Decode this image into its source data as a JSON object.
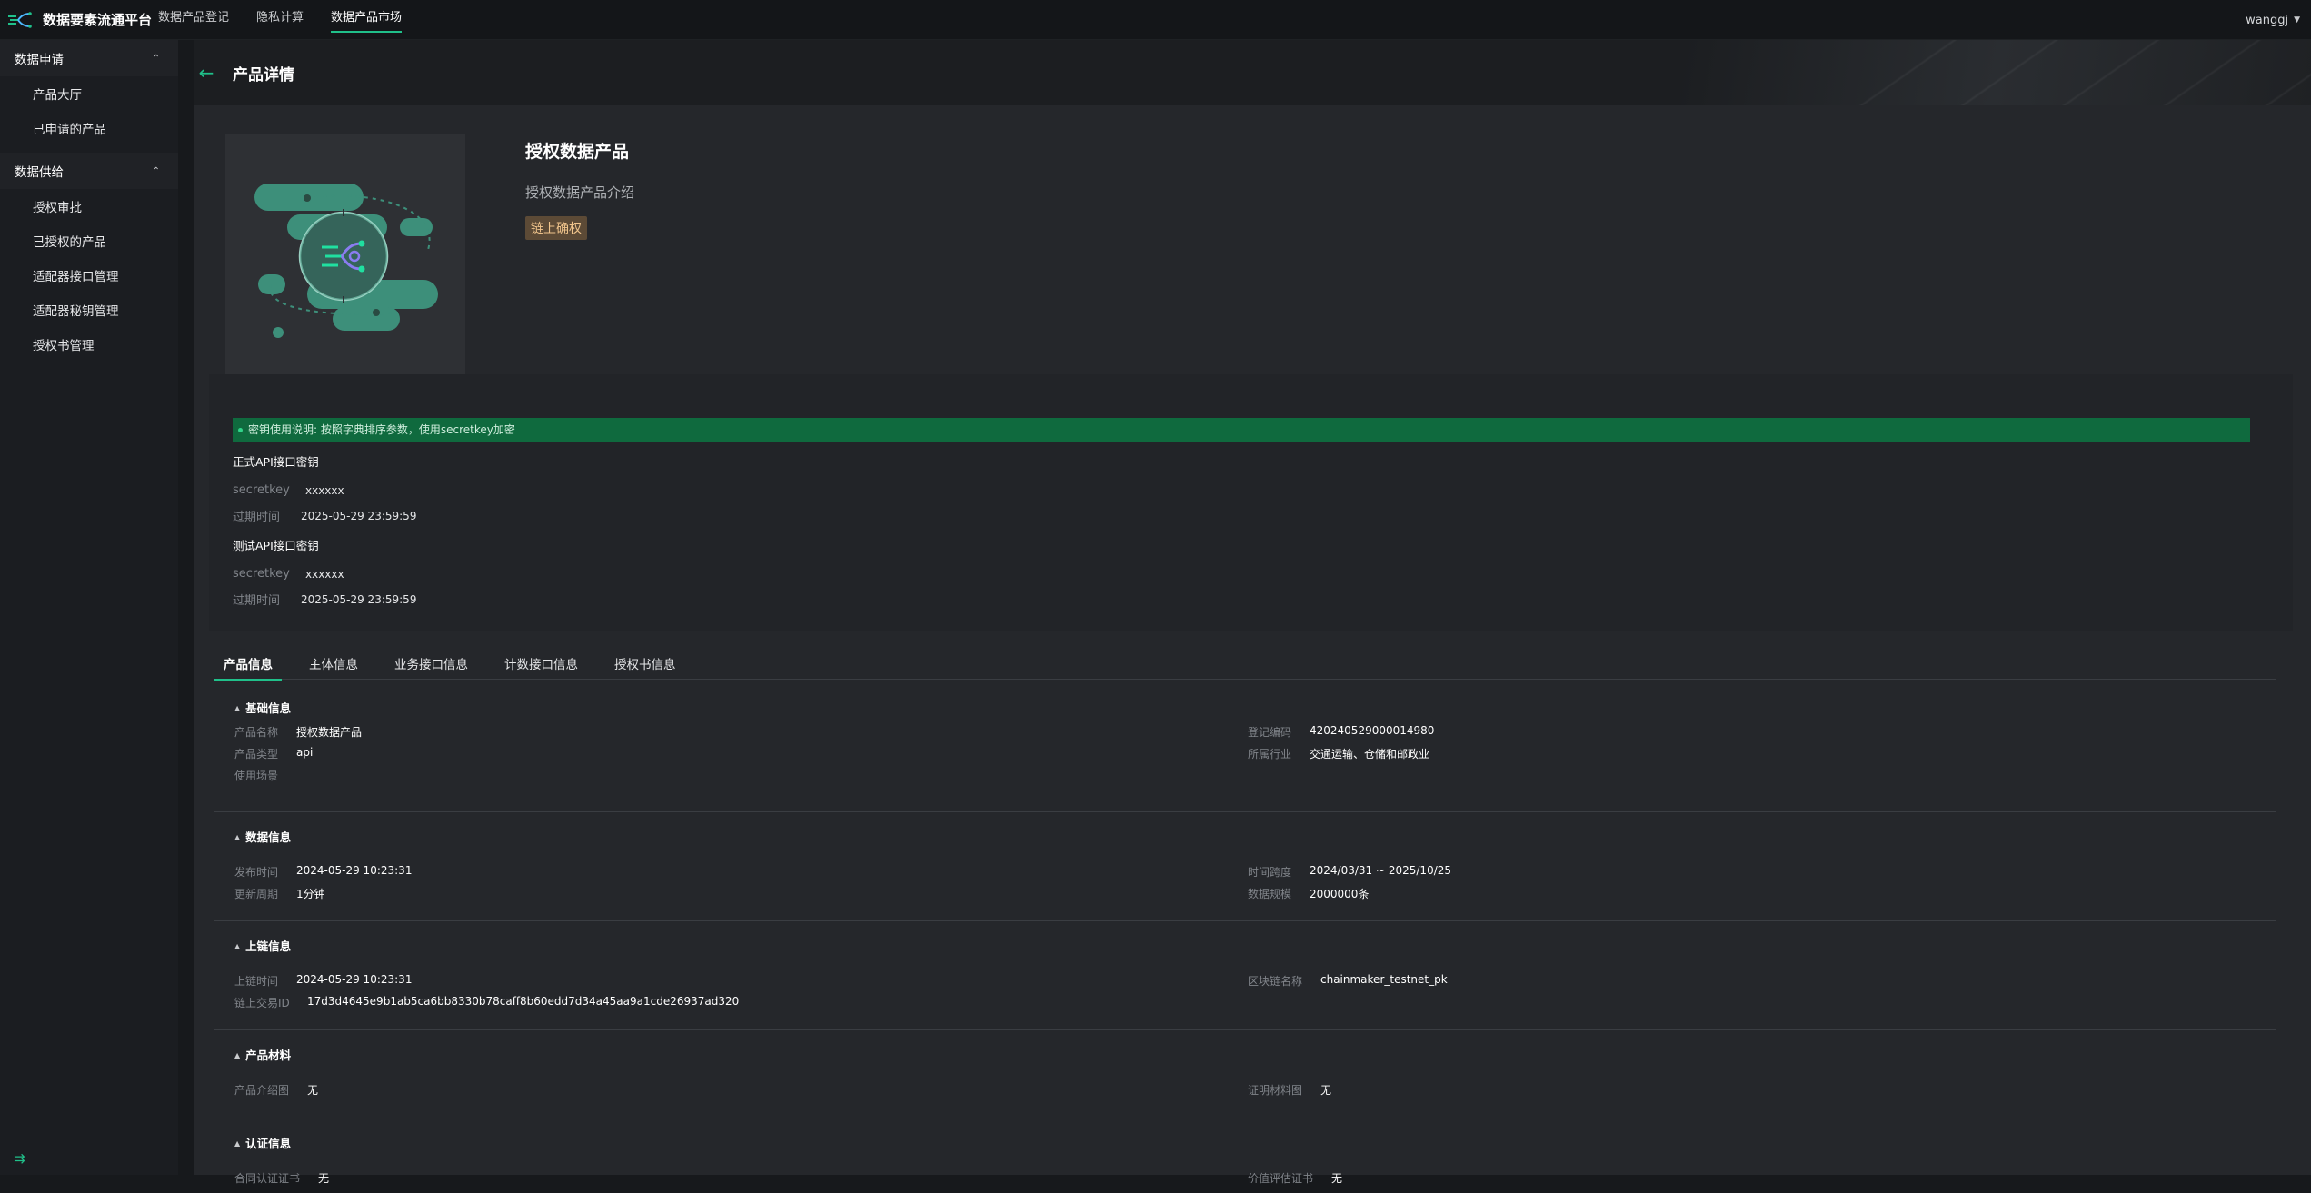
{
  "header": {
    "brand": "数据要素流通平台",
    "nav": [
      "数据产品登记",
      "隐私计算",
      "数据产品市场"
    ],
    "active_nav": "数据产品市场",
    "user": "wanggj"
  },
  "sidebar": {
    "groups": [
      {
        "title": "数据申请",
        "items": [
          "产品大厅",
          "已申请的产品"
        ]
      },
      {
        "title": "数据供给",
        "items": [
          "授权审批",
          "已授权的产品",
          "适配器接口管理",
          "适配器秘钥管理",
          "授权书管理"
        ]
      }
    ]
  },
  "page": {
    "title": "产品详情"
  },
  "product": {
    "name": "授权数据产品",
    "intro": "授权数据产品介绍",
    "tag": "链上确权"
  },
  "keys": {
    "notice": "密钥使用说明: 按照字典排序参数，使用secretkey加密",
    "formal": {
      "title": "正式API接口密钥",
      "secretkey_label": "secretkey",
      "secretkey": "xxxxxx",
      "expire_label": "过期时间",
      "expire": "2025-05-29 23:59:59"
    },
    "test": {
      "title": "测试API接口密钥",
      "secretkey_label": "secretkey",
      "secretkey": "xxxxxx",
      "expire_label": "过期时间",
      "expire": "2025-05-29 23:59:59"
    }
  },
  "tabs": [
    "产品信息",
    "主体信息",
    "业务接口信息",
    "计数接口信息",
    "授权书信息"
  ],
  "active_tab": "产品信息",
  "sections": {
    "basic": {
      "title": "基础信息",
      "name_label": "产品名称",
      "name": "授权数据产品",
      "type_label": "产品类型",
      "type": "api",
      "scene_label": "使用场景",
      "scene": "",
      "code_label": "登记编码",
      "code": "420240529000014980",
      "industry_label": "所属行业",
      "industry": "交通运输、仓储和邮政业"
    },
    "data": {
      "title": "数据信息",
      "publish_label": "发布时间",
      "publish": "2024-05-29 10:23:31",
      "cycle_label": "更新周期",
      "cycle": "1分钟",
      "span_label": "时间跨度",
      "span": "2024/03/31 ~ 2025/10/25",
      "scale_label": "数据规模",
      "scale": "2000000条"
    },
    "chain": {
      "title": "上链信息",
      "time_label": "上链时间",
      "time": "2024-05-29 10:23:31",
      "tx_label": "链上交易ID",
      "tx": "17d3d4645e9b1ab5ca6bb8330b78caff8b60edd7d34a45aa9a1cde26937ad320",
      "chain_label": "区块链名称",
      "chain": "chainmaker_testnet_pk"
    },
    "material": {
      "title": "产品材料",
      "intro_img_label": "产品介绍图",
      "intro_img": "无",
      "proof_img_label": "证明材料图",
      "proof_img": "无"
    },
    "cert": {
      "title": "认证信息",
      "contract_label": "合同认证证书",
      "contract": "无",
      "value_label": "价值评估证书",
      "value": "无"
    }
  },
  "colors": {
    "accent": "#20c08a",
    "tag_bg": "#5c4a36",
    "tag_text": "#f0c48c",
    "notice_bg": "#0f6a3e"
  }
}
